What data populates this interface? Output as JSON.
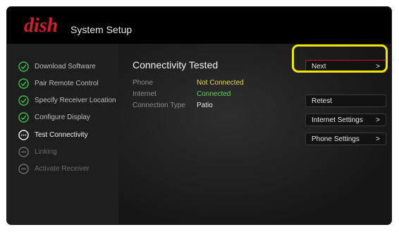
{
  "header": {
    "logo_text": "dish",
    "title": "System Setup",
    "brand_color": "#d41e2d"
  },
  "sidebar": {
    "items": [
      {
        "label": "Download Software",
        "status": "complete",
        "icon": "check-circle-icon"
      },
      {
        "label": "Pair Remote Control",
        "status": "complete",
        "icon": "check-circle-icon"
      },
      {
        "label": "Specify Receiver Location",
        "status": "complete",
        "icon": "check-circle-icon"
      },
      {
        "label": "Configure Display",
        "status": "complete",
        "icon": "check-circle-icon"
      },
      {
        "label": "Test Connectivity",
        "status": "current",
        "icon": "ellipsis-circle-icon"
      },
      {
        "label": "Linking",
        "status": "pending",
        "icon": "minus-circle-icon"
      },
      {
        "label": "Activate Receiver",
        "status": "pending",
        "icon": "minus-circle-icon"
      }
    ]
  },
  "main": {
    "title": "Connectivity Tested",
    "rows": [
      {
        "key": "Phone",
        "value": "Not Connected",
        "color": "#e8d84a"
      },
      {
        "key": "Internet",
        "value": "Connected",
        "color": "#5fd35f"
      },
      {
        "key": "Connection Type",
        "value": "Patio",
        "color": "#e6e6e6"
      }
    ]
  },
  "buttons": {
    "next": {
      "label": "Next",
      "arrow": ">"
    },
    "retest": {
      "label": "Retest"
    },
    "internet_settings": {
      "label": "Internet Settings",
      "arrow": ">"
    },
    "phone_settings": {
      "label": "Phone Settings",
      "arrow": ">"
    }
  },
  "colors": {
    "highlight": "#f2e600",
    "focus_border": "#c8102e",
    "check_green": "#3fb94a"
  }
}
